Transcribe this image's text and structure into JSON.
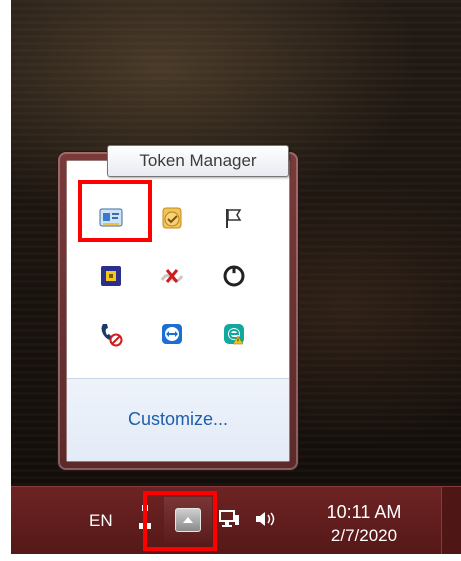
{
  "tooltip": {
    "text": "Token Manager"
  },
  "tray_popup": {
    "customize_label": "Customize...",
    "icons": [
      {
        "name": "token-manager-icon"
      },
      {
        "name": "task-checkmark-icon"
      },
      {
        "name": "flag-icon"
      },
      {
        "name": "yellow-square-app-icon"
      },
      {
        "name": "network-disconnected-icon"
      },
      {
        "name": "power-circle-icon"
      },
      {
        "name": "phone-blocked-icon"
      },
      {
        "name": "teamviewer-icon"
      },
      {
        "name": "eset-security-icon"
      }
    ]
  },
  "taskbar": {
    "language": "EN",
    "time": "10:11 AM",
    "date": "2/7/2020"
  },
  "colors": {
    "highlight": "#ff0000",
    "taskbar": "#5f1c1c",
    "link": "#1e5eab"
  }
}
